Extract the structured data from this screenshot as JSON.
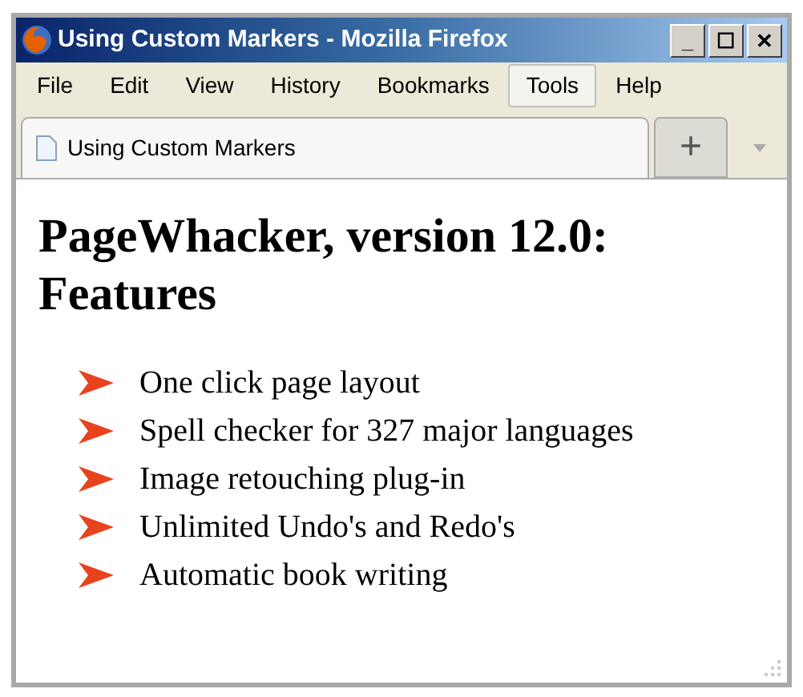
{
  "window": {
    "title": "Using Custom Markers - Mozilla Firefox",
    "controls": [
      "_",
      "☐",
      "✕"
    ]
  },
  "menu": [
    {
      "label": "File",
      "selected": false
    },
    {
      "label": "Edit",
      "selected": false
    },
    {
      "label": "View",
      "selected": false
    },
    {
      "label": "History",
      "selected": false
    },
    {
      "label": "Bookmarks",
      "selected": false
    },
    {
      "label": "Tools",
      "selected": true
    },
    {
      "label": "Help",
      "selected": false
    }
  ],
  "tabs": [
    {
      "label": "Using Custom Markers",
      "selected": true
    }
  ],
  "new_tab": "+",
  "page": {
    "heading": "PageWhacker, version 12.0: Features",
    "items": [
      "One click page layout",
      "Spell checker for 327 major languages",
      "Image retouching plug-in",
      "Unlimited Undo's and Redo's",
      "Automatic book writing"
    ]
  }
}
